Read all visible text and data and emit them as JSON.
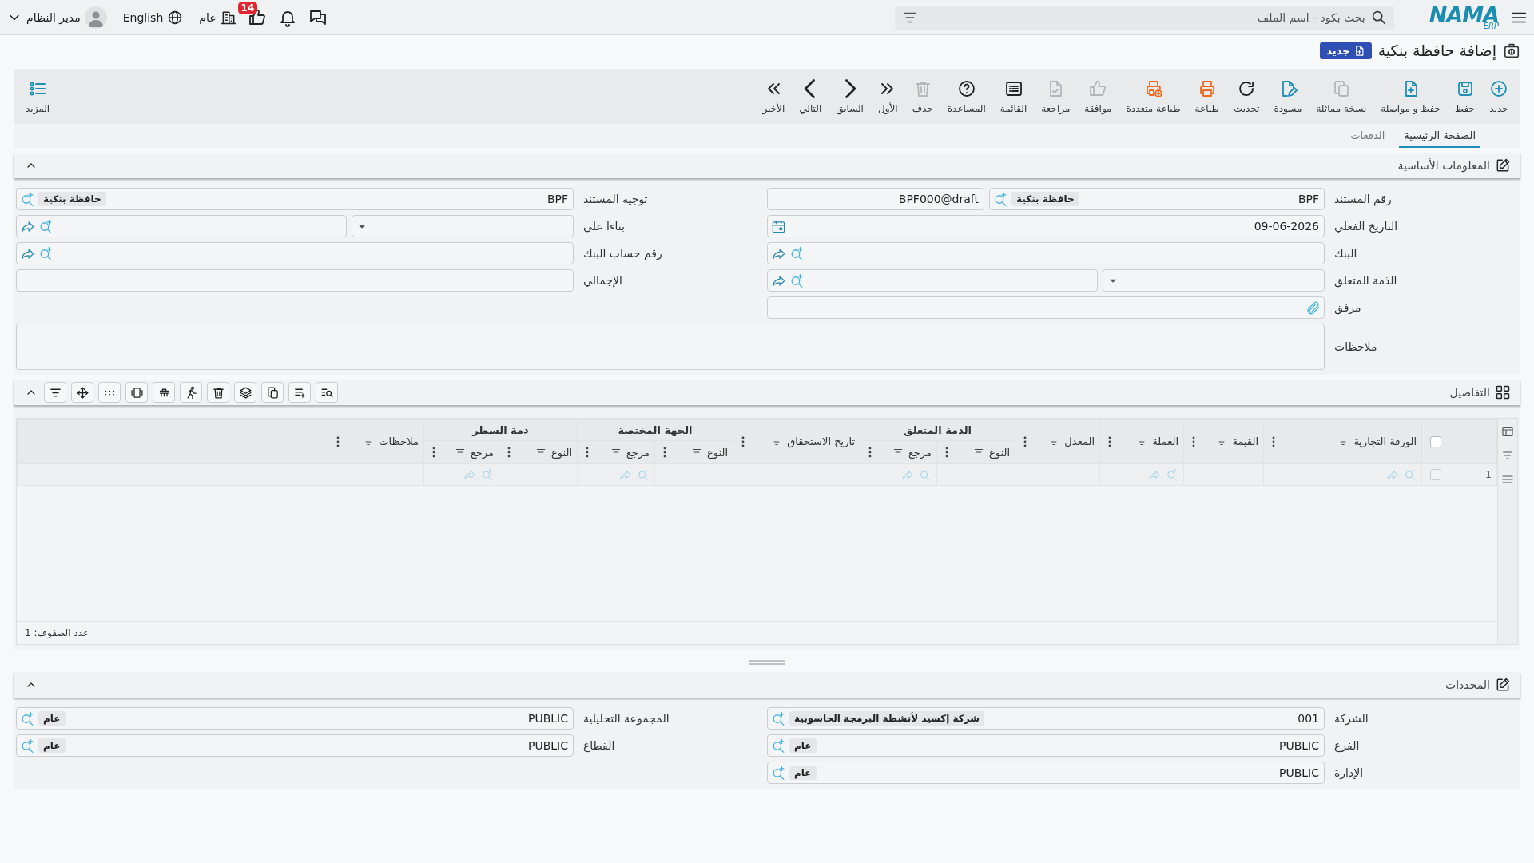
{
  "topbar": {
    "logo": "NAMA",
    "logo_sub": "ERP",
    "search": {
      "placeholder": "بحث بكود - اسم الملف"
    },
    "notifications_count": "14",
    "company": "عام",
    "language": "English",
    "user": "مدير النظام"
  },
  "page": {
    "title": "إضافة حافظة بنكية",
    "status": "جديد"
  },
  "toolbar": {
    "items": [
      {
        "label": "جديد",
        "disabled": false
      },
      {
        "label": "حفظ",
        "disabled": false
      },
      {
        "label": "حفظ و مواصلة",
        "disabled": false
      },
      {
        "label": "نسخة مماثلة",
        "disabled": true
      },
      {
        "label": "مسودة",
        "disabled": false
      },
      {
        "label": "تحديث",
        "disabled": false
      },
      {
        "label": "طباعة",
        "disabled": false
      },
      {
        "label": "طباعة متعددة",
        "disabled": false
      },
      {
        "label": "موافقة",
        "disabled": true
      },
      {
        "label": "مراجعة",
        "disabled": true
      },
      {
        "label": "القائمة",
        "disabled": false
      },
      {
        "label": "المساعدة",
        "disabled": false
      },
      {
        "label": "حذف",
        "disabled": true
      },
      {
        "label": "الأول",
        "disabled": false
      },
      {
        "label": "السابق",
        "disabled": false
      },
      {
        "label": "التالي",
        "disabled": false
      },
      {
        "label": "الأخير",
        "disabled": false
      }
    ],
    "more": "المزيد"
  },
  "tabs": [
    {
      "label": "الصفحة الرئيسية",
      "selected": true
    },
    {
      "label": "الدفعات",
      "selected": false
    }
  ],
  "basic_info": {
    "title": "المعلومات الأساسية",
    "expanded": true,
    "right_fields": [
      {
        "label": "رقم المستند",
        "kind": "code_serial",
        "value": "BPF",
        "tag": "حافظة بنكية",
        "serial": "BPF000@draft"
      },
      {
        "label": "التاريخ الفعلي",
        "kind": "date",
        "value": "09-06-2026"
      },
      {
        "label": "البنك",
        "kind": "lookup"
      },
      {
        "label": "الذمة المتعلق",
        "kind": "select_lookup"
      },
      {
        "label": "مرفق",
        "kind": "attachment"
      }
    ],
    "left_fields": [
      {
        "label": "توجيه المستند",
        "kind": "code_tag",
        "value": "BPF",
        "tag": "حافظة بنكية"
      },
      {
        "label": "بناءا على",
        "kind": "select_lookup"
      },
      {
        "label": "رقم حساب البنك",
        "kind": "lookup"
      },
      {
        "label": "الإجمالي",
        "kind": "text"
      }
    ],
    "notes": {
      "label": "ملاحظات"
    }
  },
  "details": {
    "title": "التفاصيل",
    "expanded": true,
    "table": {
      "select_all": {
        "checked": false
      },
      "columns": [
        {
          "label": "الورقة التجارية"
        },
        {
          "label": "القيمة"
        },
        {
          "label": "العملة"
        },
        {
          "label": "المعدل"
        },
        {
          "group": "الذمة المتعلق",
          "children": [
            {
              "label": "النوع"
            },
            {
              "label": "مرجع"
            }
          ]
        },
        {
          "label": "تاريخ الاستحقاق"
        },
        {
          "group": "الجهة المختصة",
          "children": [
            {
              "label": "النوع"
            },
            {
              "label": "مرجع"
            }
          ]
        },
        {
          "group": "ذمة السطر",
          "children": [
            {
              "label": "النوع"
            },
            {
              "label": "مرجع"
            }
          ]
        },
        {
          "label": "ملاحظات"
        }
      ],
      "rows": [
        {
          "number": "1",
          "checked": false,
          "cells": [
            {
              "kind": "lookup"
            },
            {
              "kind": "empty"
            },
            {
              "kind": "lookup"
            },
            {
              "kind": "empty"
            },
            {
              "kind": "empty"
            },
            {
              "kind": "lookup"
            },
            {
              "kind": "empty"
            },
            {
              "kind": "empty"
            },
            {
              "kind": "lookup"
            },
            {
              "kind": "empty"
            },
            {
              "kind": "lookup"
            },
            {
              "kind": "empty"
            }
          ]
        }
      ],
      "row_count": "عدد الصفوف: 1"
    }
  },
  "dimensions": {
    "title": "المحددات",
    "expanded": true,
    "right_fields": [
      {
        "label": "الشركة",
        "kind": "code_tag",
        "value": "001",
        "tag": "شركة إكسيد لأنشطة البرمجة الحاسوبية"
      },
      {
        "label": "الفرع",
        "kind": "code_tag",
        "value": "PUBLIC",
        "tag": "عام"
      },
      {
        "label": "الإدارة",
        "kind": "code_tag",
        "value": "PUBLIC",
        "tag": "عام"
      }
    ],
    "left_fields": [
      {
        "label": "المجموعة التحليلية",
        "kind": "code_tag",
        "value": "PUBLIC",
        "tag": "عام"
      },
      {
        "label": "القطاع",
        "kind": "code_tag",
        "value": "PUBLIC",
        "tag": "عام"
      }
    ]
  }
}
